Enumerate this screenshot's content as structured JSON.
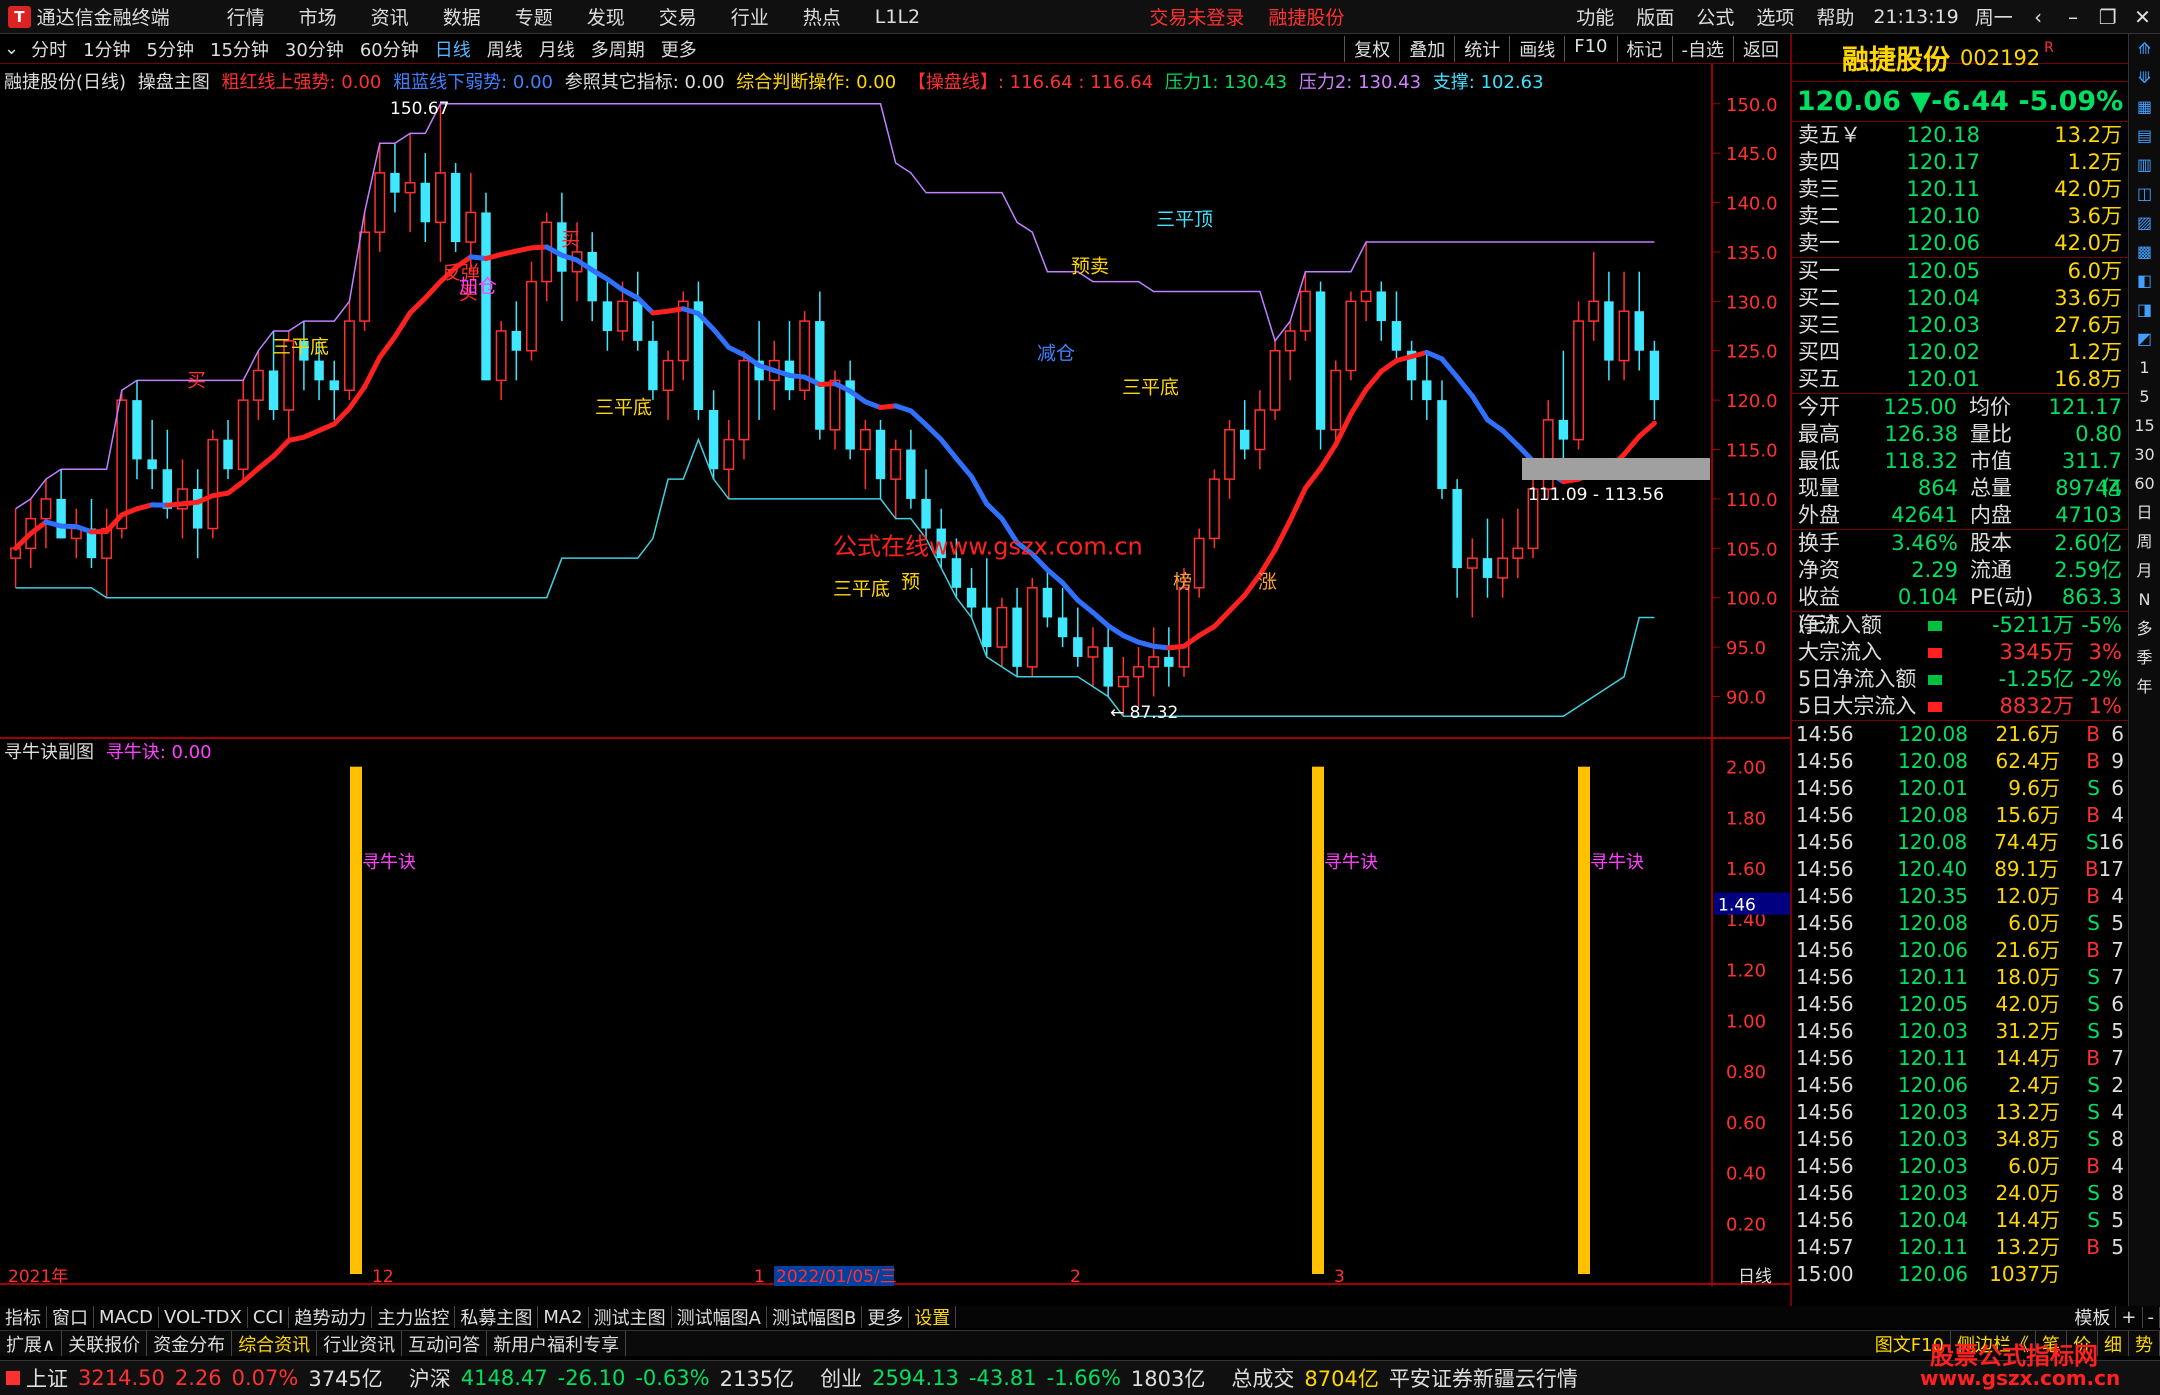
{
  "titlebar": {
    "app": "通达信金融终端",
    "menu": [
      "行情",
      "市场",
      "资讯",
      "数据",
      "专题",
      "发现",
      "交易",
      "行业",
      "热点",
      "L1L2"
    ],
    "warning1": "交易未登录",
    "warning2": "融捷股份",
    "right_menu": [
      "功能",
      "版面",
      "公式",
      "选项",
      "帮助"
    ],
    "clock": "21:13:19",
    "weekday": "周一"
  },
  "periods": [
    "分时",
    "1分钟",
    "5分钟",
    "15分钟",
    "30分钟",
    "60分钟",
    "日线",
    "周线",
    "月线",
    "多周期",
    "更多"
  ],
  "active_period": "日线",
  "tools": [
    "复权",
    "叠加",
    "统计",
    "画线",
    "F10",
    "标记",
    "-自选",
    "返回"
  ],
  "main_legend": [
    {
      "text": "融捷股份(日线)",
      "color": "#dddddd"
    },
    {
      "text": "操盘主图",
      "color": "#dddddd"
    },
    {
      "text": "粗红线上强势: 0.00",
      "color": "#ff3030"
    },
    {
      "text": "粗蓝线下弱势: 0.00",
      "color": "#4080ff"
    },
    {
      "text": "参照其它指标: 0.00",
      "color": "#dddddd"
    },
    {
      "text": "综合判断操作: 0.00",
      "color": "#ffd700"
    },
    {
      "text": "【操盘线】: 116.64 : 116.64",
      "color": "#ff3030"
    },
    {
      "text": "压力1: 130.43",
      "color": "#00e060"
    },
    {
      "text": "压力2: 130.43",
      "color": "#d080ff"
    },
    {
      "text": "支撑: 102.63",
      "color": "#40e0ff"
    }
  ],
  "sub_legend": [
    {
      "text": "寻牛诀副图",
      "color": "#dddddd"
    },
    {
      "text": "寻牛诀: 0.00",
      "color": "#ff40ff"
    }
  ],
  "chart_data": {
    "type": "candlestick",
    "y_axis": [
      "150.0",
      "145.0",
      "140.0",
      "135.0",
      "130.0",
      "125.0",
      "120.0",
      "115.0",
      "110.0",
      "105.0",
      "100.0",
      "95.0",
      "90.0"
    ],
    "sub_axis": [
      "2.00",
      "1.80",
      "1.60",
      "1.40",
      "1.20",
      "1.00",
      "0.80",
      "0.60",
      "0.40",
      "0.20"
    ],
    "sub_marker": "1.46",
    "date_labels": [
      "2021年",
      "12",
      "1",
      "2022/01/05/三",
      "2",
      "3",
      "日线"
    ],
    "high_label": "150.67",
    "low_label": "87.32",
    "range_label": "111.09 - 113.56",
    "annotations": [
      "买",
      "三平底",
      "买",
      "反弹",
      "加仓",
      "买",
      "三平底",
      "三平底",
      "预",
      "三平顶",
      "预卖",
      "减仓",
      "三平底",
      "榜",
      "涨",
      "公式在线www.gszx.com.cn"
    ],
    "sub_bar_label": "寻牛诀",
    "candles": [
      [
        104,
        109,
        101,
        105
      ],
      [
        105,
        110,
        103,
        108
      ],
      [
        108,
        112,
        105,
        110
      ],
      [
        110,
        113,
        106,
        106
      ],
      [
        106,
        109,
        104,
        107
      ],
      [
        107,
        110,
        103,
        104
      ],
      [
        104,
        109,
        100,
        107
      ],
      [
        107,
        121,
        106,
        120
      ],
      [
        120,
        122,
        112,
        114
      ],
      [
        114,
        118,
        111,
        113
      ],
      [
        113,
        117,
        108,
        109
      ],
      [
        109,
        114,
        106,
        111
      ],
      [
        111,
        113,
        104,
        107
      ],
      [
        107,
        117,
        106,
        116
      ],
      [
        116,
        118,
        112,
        113
      ],
      [
        113,
        122,
        112,
        120
      ],
      [
        120,
        125,
        118,
        123
      ],
      [
        123,
        127,
        118,
        119
      ],
      [
        119,
        127,
        116,
        126
      ],
      [
        126,
        128,
        121,
        124
      ],
      [
        124,
        126,
        120,
        122
      ],
      [
        122,
        124,
        118,
        121
      ],
      [
        121,
        130,
        120,
        128
      ],
      [
        128,
        139,
        127,
        137
      ],
      [
        137,
        146,
        135,
        143
      ],
      [
        143,
        146,
        139,
        141
      ],
      [
        141,
        147,
        137,
        142
      ],
      [
        142,
        145,
        136,
        138
      ],
      [
        138,
        150,
        134,
        143
      ],
      [
        143,
        144,
        135,
        136
      ],
      [
        136,
        143,
        133,
        139
      ],
      [
        139,
        141,
        122,
        122
      ],
      [
        122,
        128,
        120,
        127
      ],
      [
        127,
        130,
        122,
        125
      ],
      [
        125,
        134,
        124,
        132
      ],
      [
        132,
        139,
        130,
        138
      ],
      [
        138,
        141,
        128,
        133
      ],
      [
        133,
        138,
        130,
        135
      ],
      [
        135,
        137,
        128,
        130
      ],
      [
        130,
        132,
        125,
        127
      ],
      [
        127,
        132,
        126,
        130
      ],
      [
        130,
        133,
        125,
        126
      ],
      [
        126,
        128,
        120,
        121
      ],
      [
        121,
        125,
        118,
        124
      ],
      [
        124,
        131,
        122,
        130
      ],
      [
        130,
        132,
        118,
        119
      ],
      [
        119,
        121,
        112,
        113
      ],
      [
        113,
        118,
        110,
        116
      ],
      [
        116,
        125,
        114,
        124
      ],
      [
        124,
        128,
        118,
        122
      ],
      [
        122,
        126,
        119,
        124
      ],
      [
        124,
        128,
        120,
        121
      ],
      [
        121,
        129,
        120,
        128
      ],
      [
        128,
        131,
        116,
        117
      ],
      [
        117,
        123,
        115,
        122
      ],
      [
        122,
        124,
        114,
        115
      ],
      [
        115,
        118,
        111,
        117
      ],
      [
        117,
        118,
        110,
        112
      ],
      [
        112,
        116,
        108,
        115
      ],
      [
        115,
        117,
        109,
        110
      ],
      [
        110,
        113,
        106,
        107
      ],
      [
        107,
        109,
        103,
        104
      ],
      [
        104,
        106,
        100,
        101
      ],
      [
        101,
        103,
        98,
        99
      ],
      [
        99,
        104,
        94,
        95
      ],
      [
        95,
        100,
        93,
        99
      ],
      [
        99,
        101,
        92,
        93
      ],
      [
        93,
        102,
        92,
        101
      ],
      [
        101,
        103,
        97,
        98
      ],
      [
        98,
        101,
        95,
        96
      ],
      [
        96,
        99,
        93,
        94
      ],
      [
        94,
        97,
        91,
        95
      ],
      [
        95,
        97,
        90,
        91
      ],
      [
        91,
        94,
        88,
        92
      ],
      [
        92,
        95,
        89,
        93
      ],
      [
        93,
        97,
        90,
        94
      ],
      [
        94,
        97,
        91,
        93
      ],
      [
        93,
        103,
        92,
        101
      ],
      [
        101,
        107,
        100,
        106
      ],
      [
        106,
        113,
        105,
        112
      ],
      [
        112,
        118,
        110,
        117
      ],
      [
        117,
        120,
        114,
        115
      ],
      [
        115,
        121,
        113,
        119
      ],
      [
        119,
        126,
        118,
        125
      ],
      [
        125,
        128,
        122,
        127
      ],
      [
        127,
        133,
        126,
        131
      ],
      [
        131,
        132,
        115,
        117
      ],
      [
        117,
        124,
        116,
        123
      ],
      [
        123,
        131,
        122,
        130
      ],
      [
        130,
        136,
        128,
        131
      ],
      [
        131,
        132,
        126,
        128
      ],
      [
        128,
        131,
        124,
        125
      ],
      [
        125,
        126,
        120,
        122
      ],
      [
        122,
        125,
        118,
        120
      ],
      [
        120,
        122,
        110,
        111
      ],
      [
        111,
        112,
        100,
        103
      ],
      [
        103,
        106,
        98,
        104
      ],
      [
        104,
        108,
        100,
        102
      ],
      [
        102,
        108,
        100,
        104
      ],
      [
        104,
        109,
        102,
        105
      ],
      [
        105,
        112,
        104,
        111
      ],
      [
        111,
        120,
        110,
        118
      ],
      [
        118,
        125,
        114,
        116
      ],
      [
        116,
        130,
        115,
        128
      ],
      [
        128,
        135,
        126,
        130
      ],
      [
        130,
        133,
        122,
        124
      ],
      [
        124,
        133,
        122,
        129
      ],
      [
        129,
        133,
        123,
        125
      ],
      [
        125,
        126,
        118,
        120
      ]
    ]
  },
  "right": {
    "name": "融捷股份",
    "code": "002192",
    "flag": "R",
    "price": "120.06",
    "change": "▼-6.44",
    "pct": "-5.09%",
    "asks": [
      {
        "l": "卖五￥",
        "p": "120.18",
        "v": "13.2万"
      },
      {
        "l": "卖四",
        "p": "120.17",
        "v": "1.2万"
      },
      {
        "l": "卖三",
        "p": "120.11",
        "v": "42.0万"
      },
      {
        "l": "卖二",
        "p": "120.10",
        "v": "3.6万"
      },
      {
        "l": "卖一",
        "p": "120.06",
        "v": "42.0万"
      }
    ],
    "bids": [
      {
        "l": "买一",
        "p": "120.05",
        "v": "6.0万"
      },
      {
        "l": "买二",
        "p": "120.04",
        "v": "33.6万"
      },
      {
        "l": "买三",
        "p": "120.03",
        "v": "27.6万"
      },
      {
        "l": "买四",
        "p": "120.02",
        "v": "1.2万"
      },
      {
        "l": "买五",
        "p": "120.01",
        "v": "16.8万"
      }
    ],
    "stats": [
      [
        "今开",
        "125.00",
        "均价",
        "121.17"
      ],
      [
        "最高",
        "126.38",
        "量比",
        "0.80"
      ],
      [
        "最低",
        "118.32",
        "市值",
        "311.7亿"
      ],
      [
        "现量",
        "864",
        "总量",
        "89744"
      ],
      [
        "外盘",
        "42641",
        "内盘",
        "47103"
      ]
    ],
    "stats2": [
      [
        "换手",
        "3.46%",
        "股本",
        "2.60亿"
      ],
      [
        "净资",
        "2.29",
        "流通",
        "2.59亿"
      ],
      [
        "收益(三)",
        "0.104",
        "PE(动)",
        "863.3"
      ]
    ],
    "flows": [
      {
        "l": "净流入额",
        "v": "-5211万",
        "p": "-5%"
      },
      {
        "l": "大宗流入",
        "v": "3345万",
        "p": "3%"
      },
      {
        "l": "5日净流入额",
        "v": "-1.25亿",
        "p": "-2%"
      },
      {
        "l": "5日大宗流入",
        "v": "8832万",
        "p": "1%"
      }
    ],
    "ticks": [
      [
        "14:56",
        "120.08",
        "21.6万",
        "B",
        "6"
      ],
      [
        "14:56",
        "120.08",
        "62.4万",
        "B",
        "9"
      ],
      [
        "14:56",
        "120.01",
        "9.6万",
        "S",
        "6"
      ],
      [
        "14:56",
        "120.08",
        "15.6万",
        "B",
        "4"
      ],
      [
        "14:56",
        "120.08",
        "74.4万",
        "S",
        "16"
      ],
      [
        "14:56",
        "120.40",
        "89.1万",
        "B",
        "17"
      ],
      [
        "14:56",
        "120.35",
        "12.0万",
        "B",
        "4"
      ],
      [
        "14:56",
        "120.08",
        "6.0万",
        "S",
        "5"
      ],
      [
        "14:56",
        "120.06",
        "21.6万",
        "B",
        "7"
      ],
      [
        "14:56",
        "120.11",
        "18.0万",
        "S",
        "7"
      ],
      [
        "14:56",
        "120.05",
        "42.0万",
        "S",
        "6"
      ],
      [
        "14:56",
        "120.03",
        "31.2万",
        "S",
        "5"
      ],
      [
        "14:56",
        "120.11",
        "14.4万",
        "B",
        "7"
      ],
      [
        "14:56",
        "120.06",
        "2.4万",
        "S",
        "2"
      ],
      [
        "14:56",
        "120.03",
        "13.2万",
        "S",
        "4"
      ],
      [
        "14:56",
        "120.03",
        "34.8万",
        "S",
        "8"
      ],
      [
        "14:56",
        "120.03",
        "6.0万",
        "B",
        "4"
      ],
      [
        "14:56",
        "120.03",
        "24.0万",
        "S",
        "8"
      ],
      [
        "14:56",
        "120.04",
        "14.4万",
        "S",
        "5"
      ],
      [
        "14:57",
        "120.11",
        "13.2万",
        "B",
        "5"
      ],
      [
        "15:00",
        "120.06",
        "1037万",
        "",
        ""
      ]
    ]
  },
  "side_icons": [
    "1",
    "5",
    "15",
    "30",
    "60",
    "日",
    "周",
    "月",
    "N",
    "多",
    "季",
    "年"
  ],
  "tabs": [
    "指标",
    "窗口",
    "MACD",
    "VOL-TDX",
    "CCI",
    "趋势动力",
    "主力监控",
    "私募主图",
    "MA2",
    "测试主图",
    "测试幅图A",
    "测试幅图B",
    "更多",
    "设置"
  ],
  "tabs_right": [
    "模板",
    "+",
    "-"
  ],
  "info": [
    "扩展∧",
    "关联报价",
    "资金分布",
    "综合资讯",
    "行业资讯",
    "互动问答",
    "新用户福利专享"
  ],
  "info_right": [
    "图文F10",
    "侧边栏《",
    "笔",
    "价",
    "细",
    "势"
  ],
  "status": [
    {
      "n": "上证",
      "v": "3214.50",
      "c": "2.26",
      "p": "0.07%",
      "a": "3745亿"
    },
    {
      "n": "沪深",
      "v": "4148.47",
      "c": "-26.10",
      "p": "-0.63%",
      "a": "2135亿"
    },
    {
      "n": "创业",
      "v": "2594.13",
      "c": "-43.81",
      "p": "-1.66%",
      "a": "1803亿"
    }
  ],
  "status_total_label": "总成交",
  "status_total": "8704亿",
  "status_broker": "平安证券新疆云行情",
  "watermark": "股票公式指标网",
  "watermark_url": "www.gszx.com.cn"
}
